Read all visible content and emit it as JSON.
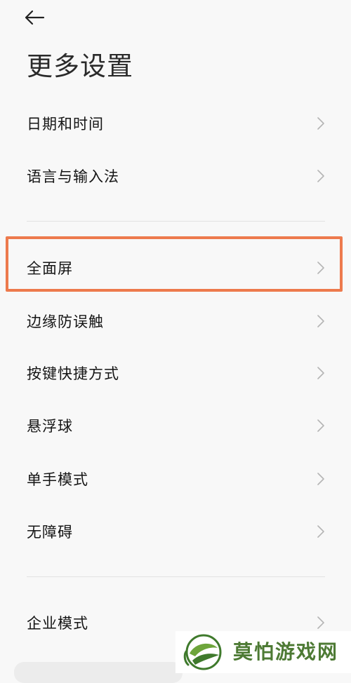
{
  "header": {
    "title": "更多设置"
  },
  "groups": [
    [
      "日期和时间",
      "语言与输入法"
    ],
    [
      "全面屏",
      "边缘防误触",
      "按键快捷方式",
      "悬浮球",
      "单手模式",
      "无障碍"
    ],
    [
      "企业模式"
    ]
  ],
  "items": [
    {
      "label": "日期和时间"
    },
    {
      "label": "语言与输入法"
    },
    {
      "label": "全面屏",
      "highlighted": true
    },
    {
      "label": "边缘防误触"
    },
    {
      "label": "按键快捷方式"
    },
    {
      "label": "悬浮球"
    },
    {
      "label": "单手模式"
    },
    {
      "label": "无障碍"
    },
    {
      "label": "企业模式"
    }
  ],
  "highlight_color": "#ed7a4d",
  "watermark": {
    "text": "莫怕游戏网",
    "color": "#4d7a34"
  },
  "icons": {
    "back": "arrow-left-icon",
    "chevron": "chevron-right-icon"
  }
}
